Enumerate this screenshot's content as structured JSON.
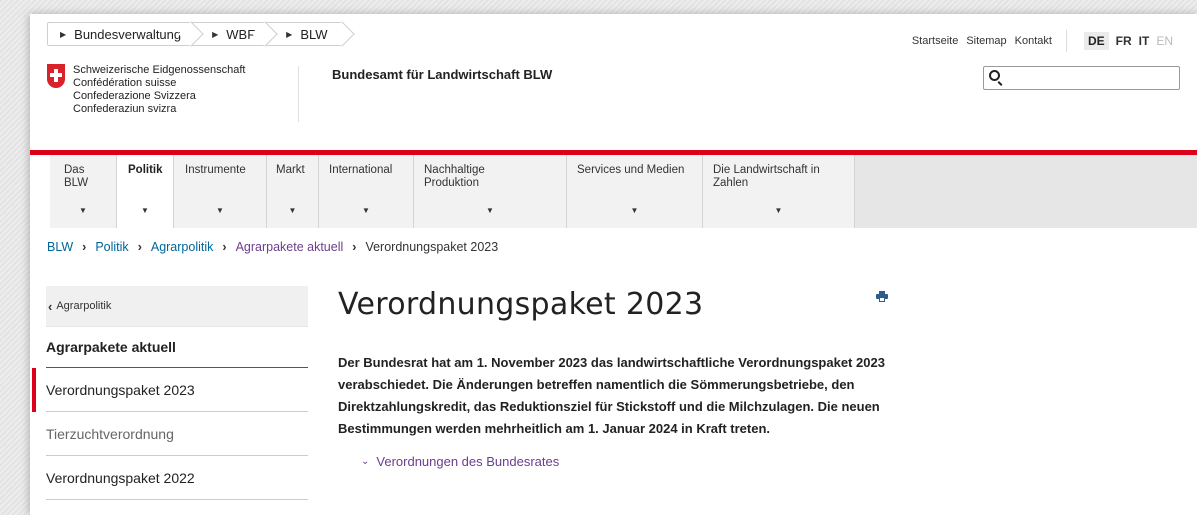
{
  "topnav": [
    "Bundesverwaltung",
    "WBF",
    "BLW"
  ],
  "utility": {
    "links": [
      "Startseite",
      "Sitemap",
      "Kontakt"
    ],
    "languages": [
      {
        "code": "DE",
        "state": "active"
      },
      {
        "code": "FR",
        "state": "normal"
      },
      {
        "code": "IT",
        "state": "normal"
      },
      {
        "code": "EN",
        "state": "disabled"
      }
    ]
  },
  "logo": {
    "lines": [
      "Schweizerische Eidgenossenschaft",
      "Confédération suisse",
      "Confederazione Svizzera",
      "Confederaziun svizra"
    ]
  },
  "office_name": "Bundesamt für Landwirtschaft BLW",
  "search": {
    "placeholder": ""
  },
  "mainnav": [
    {
      "label": "Das BLW",
      "active": false
    },
    {
      "label": "Politik",
      "active": true
    },
    {
      "label": "Instrumente",
      "active": false
    },
    {
      "label": "Markt",
      "active": false
    },
    {
      "label": "International",
      "active": false
    },
    {
      "label": "Nachhaltige Produktion",
      "active": false
    },
    {
      "label": "Services und Medien",
      "active": false
    },
    {
      "label": "Die Landwirtschaft in Zahlen",
      "active": false
    }
  ],
  "breadcrumb": {
    "items": [
      "BLW",
      "Politik",
      "Agrarpolitik",
      "Agrarpakete aktuell"
    ],
    "current": "Verordnungspaket 2023"
  },
  "sidebar": {
    "back_label": "Agrarpolitik",
    "heading": "Agrarpakete aktuell",
    "items": [
      {
        "label": "Verordnungspaket 2023",
        "state": "active"
      },
      {
        "label": "Tierzuchtverordnung",
        "state": "muted"
      },
      {
        "label": "Verordnungspaket 2022",
        "state": "normal"
      }
    ]
  },
  "content": {
    "title": "Verordnungspaket 2023",
    "lead": "Der Bundesrat hat am 1. November 2023 das landwirtschaftliche Verordnungspaket 2023 verabschiedet. Die Änderungen betreffen namentlich die Sömmerungsbetriebe, den Direktzahlungskredit, das Reduktionsziel für Stickstoff und die Milchzulagen. Die neuen Bestimmungen werden mehrheitlich am 1. Januar 2024 in Kraft treten.",
    "accordion_label": "Verordnungen des Bundesrates"
  },
  "colors": {
    "accent_red": "#dc0018",
    "link_blue": "#006699",
    "accordion_purple": "#6b3e8e"
  }
}
